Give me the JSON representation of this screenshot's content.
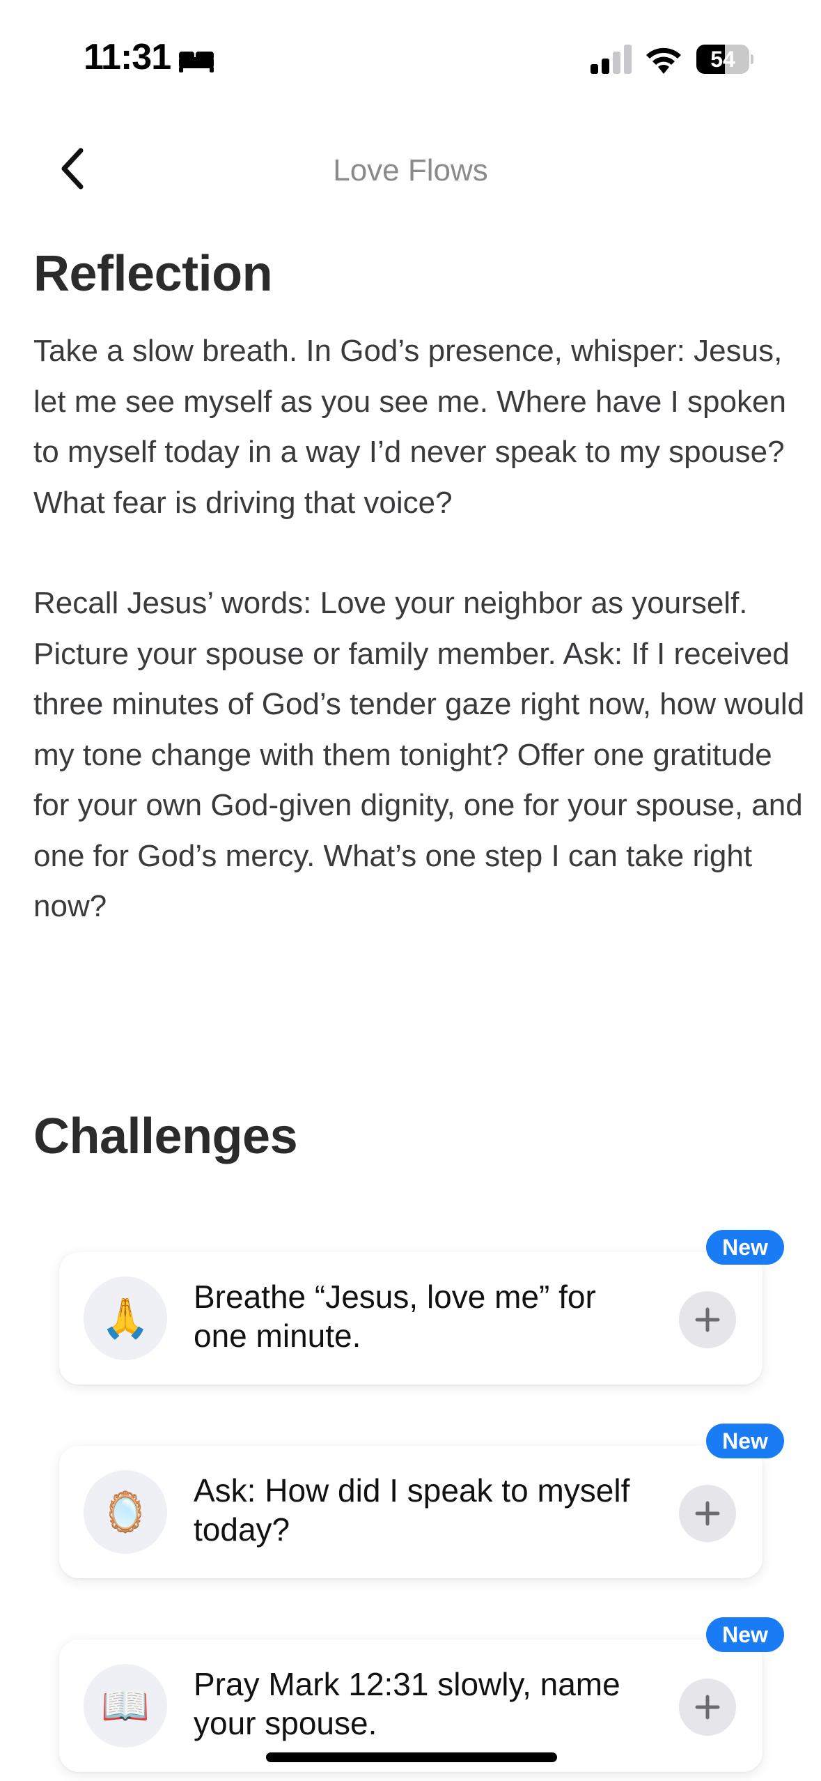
{
  "status_bar": {
    "time": "11:31",
    "battery_level": "54",
    "battery_fraction": 0.54,
    "icons": [
      "bed-icon",
      "cellular-signal-icon",
      "wifi-icon",
      "battery-icon"
    ]
  },
  "nav": {
    "title": "Love Flows",
    "back_icon": "chevron-left-icon"
  },
  "reflection": {
    "heading": "Reflection",
    "paragraphs": [
      "Take a slow breath. In God’s presence, whisper: Jesus, let me see myself as you see me. Where have I spoken to myself today in a way I’d never speak to my spouse? What fear is driving that voice?",
      "Recall Jesus’ words: Love your neighbor as yourself. Picture your spouse or family member. Ask: If I received three minutes of God’s tender gaze right now, how would my tone change with them tonight? Offer one gratitude for your own God-given dignity, one for your spouse, and one for God’s mercy. What’s one step I can take right now?"
    ]
  },
  "challenges": {
    "heading": "Challenges",
    "items": [
      {
        "emoji": "🙏",
        "icon_name": "praying-hands-icon",
        "text": "Breathe “Jesus, love me” for one minute.",
        "badge": "New"
      },
      {
        "emoji": "🪞",
        "icon_name": "mirror-icon",
        "text": "Ask: How did I speak to myself today?",
        "badge": "New"
      },
      {
        "emoji": "📖",
        "icon_name": "open-book-icon",
        "text": "Pray Mark 12:31 slowly, name your spouse.",
        "badge": "New"
      }
    ]
  },
  "colors": {
    "badge_blue": "#1a7cf5",
    "text_primary": "#2b2b2b",
    "nav_title_gray": "#8a8a8e",
    "add_button_bg": "#e5e5ea",
    "emoji_circle_bg": "#eef0f5"
  }
}
